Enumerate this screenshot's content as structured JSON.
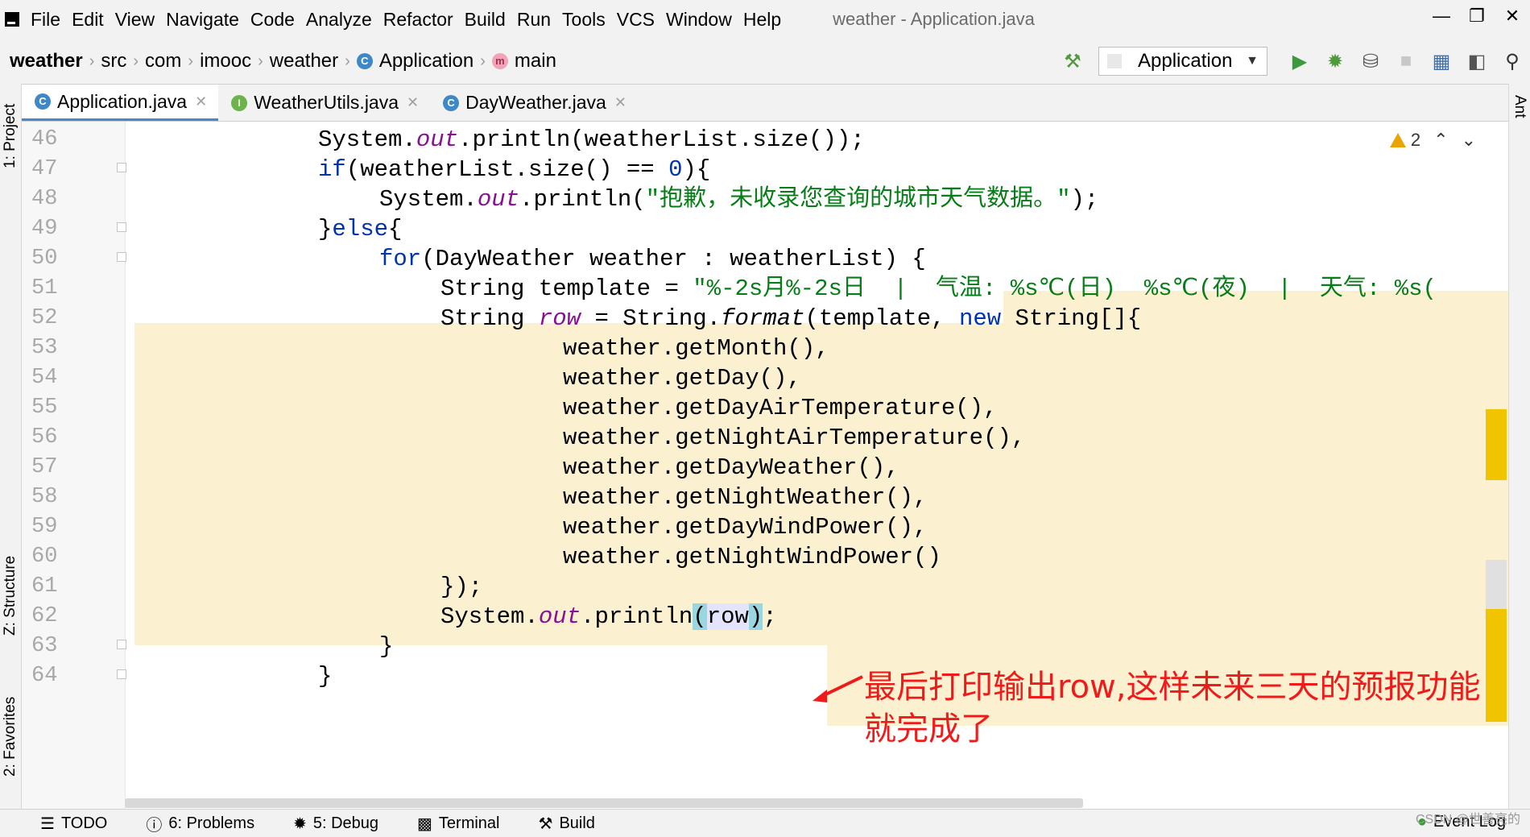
{
  "menubar": {
    "items": [
      "File",
      "Edit",
      "View",
      "Navigate",
      "Code",
      "Analyze",
      "Refactor",
      "Build",
      "Run",
      "Tools",
      "VCS",
      "Window",
      "Help"
    ],
    "window_title": "weather - Application.java"
  },
  "breadcrumbs": [
    "weather",
    "src",
    "com",
    "imooc",
    "weather",
    "Application",
    "main"
  ],
  "run_config": "Application",
  "tabs": [
    {
      "label": "Application.java",
      "icon": "class-icon",
      "active": true
    },
    {
      "label": "WeatherUtils.java",
      "icon": "interface-icon",
      "active": false
    },
    {
      "label": "DayWeather.java",
      "icon": "class-icon",
      "active": false
    }
  ],
  "left_tool_windows": [
    "1: Project",
    "Z: Structure",
    "2: Favorites"
  ],
  "right_tool_windows": [
    "Ant"
  ],
  "inspection": {
    "warnings": "2"
  },
  "code_lines": [
    {
      "n": "46",
      "t1": "System.",
      "it": "out",
      "t2": ".println(weatherList.size());"
    },
    {
      "n": "47",
      "kw": "if",
      "t": "(weatherList.size() == ",
      "num": "0",
      "t2": "){"
    },
    {
      "n": "48",
      "t1": "System.",
      "it": "out",
      "t2": ".println(",
      "str": "\"抱歉，未收录您查询的城市天气数据。\"",
      "t3": ");"
    },
    {
      "n": "49",
      "t1": "}",
      "kw": "else",
      "t2": "{"
    },
    {
      "n": "50",
      "kw": "for",
      "t": "(DayWeather weather : weatherList) {"
    },
    {
      "n": "51",
      "t": "String template = ",
      "str": "\"%-2s月%-2s日  |  气温: %s℃(日)  %s℃(夜)  |  天气: %s("
    },
    {
      "n": "52",
      "t1": "String ",
      "var": "row",
      "t2": " = String.",
      "itb": "format",
      "t3": "(template, ",
      "kw": "new",
      "t4": " String[]{"
    },
    {
      "n": "53",
      "t": "weather.getMonth(),"
    },
    {
      "n": "54",
      "t": "weather.getDay(),"
    },
    {
      "n": "55",
      "t": "weather.getDayAirTemperature(),"
    },
    {
      "n": "56",
      "t": "weather.getNightAirTemperature(),"
    },
    {
      "n": "57",
      "t": "weather.getDayWeather(),"
    },
    {
      "n": "58",
      "t": "weather.getNightWeather(),"
    },
    {
      "n": "59",
      "t": "weather.getDayWindPower(),"
    },
    {
      "n": "60",
      "t": "weather.getNightWindPower()"
    },
    {
      "n": "61",
      "t": "});"
    },
    {
      "n": "62",
      "t1": "System.",
      "it": "out",
      "t2": ".println",
      "b1": "(",
      "var": "row",
      "b2": ")",
      "t3": ";"
    },
    {
      "n": "63",
      "t": "}"
    },
    {
      "n": "64",
      "t": "}"
    }
  ],
  "annotation": {
    "line1": "最后打印输出row,这样未来三天的预报功能",
    "line2": "就完成了",
    "color": "#f01a1a"
  },
  "statusbar": {
    "items": [
      "TODO",
      "6: Problems",
      "5: Debug",
      "Terminal",
      "Build"
    ],
    "event_log": "Event Log",
    "watermark": "CSDN @世善亮的"
  },
  "colors": {
    "keyword": "#0033b3",
    "string": "#067d17",
    "static_field": "#871094",
    "highlight": "#fbf0cf",
    "tab_underline": "#4a88c7"
  }
}
